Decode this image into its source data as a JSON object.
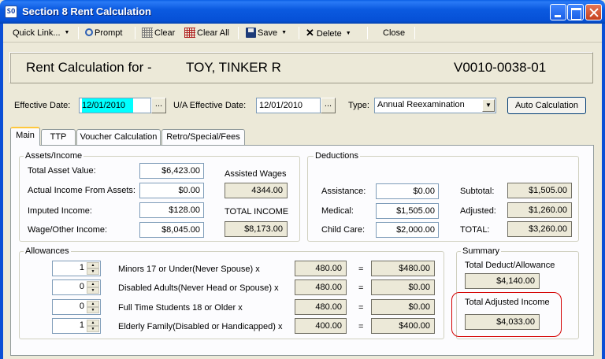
{
  "window": {
    "title": "Section 8 Rent Calculation",
    "icon_text": "SO"
  },
  "toolbar": {
    "quick_link": "Quick Link...",
    "prompt": "Prompt",
    "clear": "Clear",
    "clear_all": "Clear All",
    "save": "Save",
    "delete": "Delete",
    "close": "Close"
  },
  "header": {
    "label": "Rent Calculation for -",
    "tenant_name": "TOY, TINKER R",
    "voucher_id": "V0010-0038-01"
  },
  "dates": {
    "effective_label": "Effective Date:",
    "effective_value": "12/01/2010",
    "ua_label": "U/A Effective Date:",
    "ua_value": "12/01/2010",
    "type_label": "Type:",
    "type_value": "Annual Reexamination",
    "auto_calc": "Auto Calculation",
    "dots": "..."
  },
  "tabs": [
    "Main",
    "TTP",
    "Voucher Calculation",
    "Retro/Special/Fees"
  ],
  "assets": {
    "title": "Assets/Income",
    "total_asset_label": "Total Asset Value:",
    "total_asset": "$6,423.00",
    "actual_income_label": "Actual Income From Assets:",
    "actual_income": "$0.00",
    "imputed_label": "Imputed Income:",
    "imputed": "$128.00",
    "wage_label": "Wage/Other Income:",
    "wage": "$8,045.00",
    "assisted_wages_label": "Assisted Wages",
    "assisted_wages": "4344.00",
    "total_income_label": "TOTAL INCOME",
    "total_income": "$8,173.00"
  },
  "deductions": {
    "title": "Deductions",
    "assistance_label": "Assistance:",
    "assistance": "$0.00",
    "medical_label": "Medical:",
    "medical": "$1,505.00",
    "childcare_label": "Child Care:",
    "childcare": "$2,000.00",
    "subtotal_label": "Subtotal:",
    "subtotal": "$1,505.00",
    "adjusted_label": "Adjusted:",
    "adjusted": "$1,260.00",
    "total_label": "TOTAL:",
    "total": "$3,260.00"
  },
  "allowances": {
    "title": "Allowances",
    "rows": [
      {
        "count": "1",
        "label": "Minors 17 or Under(Never Spouse) x",
        "rate": "480.00",
        "eq": "=",
        "amount": "$480.00"
      },
      {
        "count": "0",
        "label": "Disabled Adults(Never Head or Spouse) x",
        "rate": "480.00",
        "eq": "=",
        "amount": "$0.00"
      },
      {
        "count": "0",
        "label": "Full Time Students 18 or Older x",
        "rate": "480.00",
        "eq": "=",
        "amount": "$0.00"
      },
      {
        "count": "1",
        "label": "Elderly Family(Disabled or Handicapped) x",
        "rate": "400.00",
        "eq": "=",
        "amount": "$400.00"
      }
    ]
  },
  "summary": {
    "title": "Summary",
    "deduct_label": "Total Deduct/Allowance",
    "deduct_value": "$4,140.00",
    "adjusted_income_label": "Total Adjusted Income",
    "adjusted_income_value": "$4,033.00"
  },
  "colors": {
    "title_bar": "#0a5fe4",
    "highlight": "#00ffff",
    "annotation_ring": "#d40000"
  }
}
